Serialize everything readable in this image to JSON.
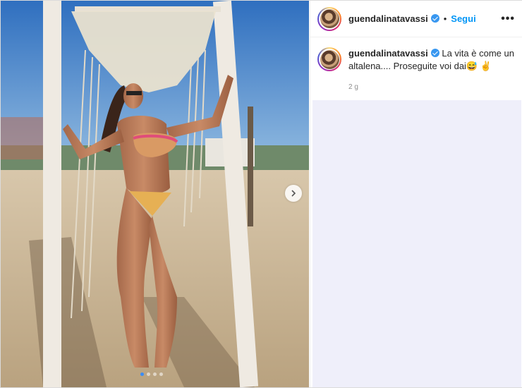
{
  "post": {
    "username": "guendalinatavassi",
    "separator": "•",
    "follow_label": "Segui",
    "more_label": "•••",
    "caption_text": "La vita è come un altalena.... Proseguite voi dai😅 ✌️",
    "time_ago": "2 g"
  },
  "media": {
    "carousel_count": 4,
    "carousel_active": 1
  },
  "icons": {
    "verified": "verified-badge-icon",
    "next": "chevron-right-icon",
    "more": "more-options-icon"
  },
  "colors": {
    "accent": "#0095f6",
    "verified": "#3897f0",
    "comments_bg": "#efeffa"
  }
}
